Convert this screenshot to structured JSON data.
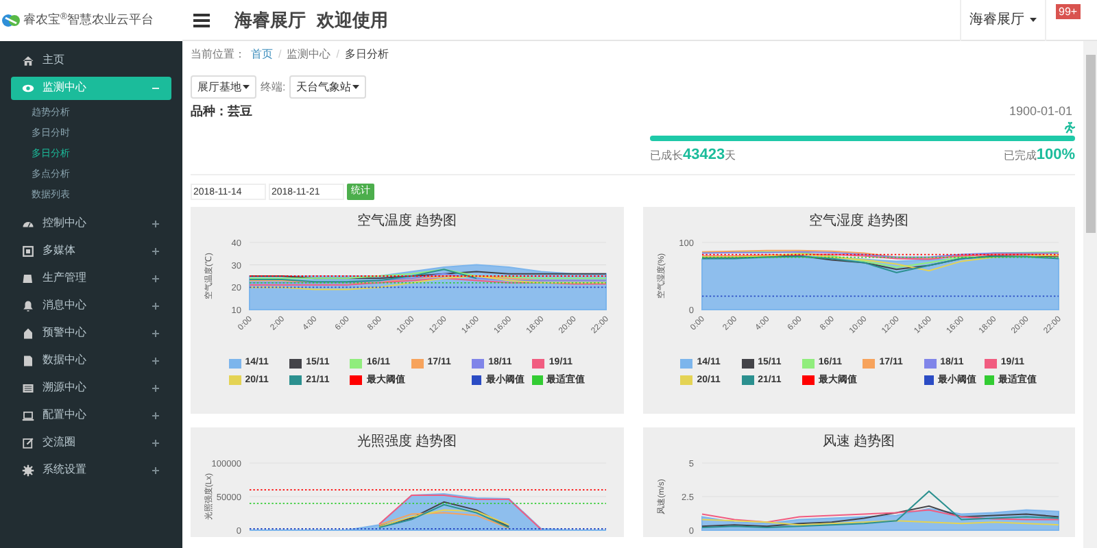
{
  "logo": {
    "text": "睿农宝$^{®}$智慧农业云平台"
  },
  "sidebar": {
    "items": [
      {
        "label": "主页",
        "selected": false,
        "expandable": false
      },
      {
        "label": "监测中心",
        "selected": true,
        "expandable": true,
        "expanded": true,
        "children": [
          {
            "label": "趋势分析",
            "selected": false
          },
          {
            "label": "多日分时",
            "selected": false
          },
          {
            "label": "多日分析",
            "selected": true
          },
          {
            "label": "多点分析",
            "selected": false
          },
          {
            "label": "数据列表",
            "selected": false
          }
        ]
      },
      {
        "label": "控制中心",
        "selected": false,
        "expandable": true,
        "expanded": false
      },
      {
        "label": "多媒体",
        "selected": false,
        "expandable": true,
        "expanded": false
      },
      {
        "label": "生产管理",
        "selected": false,
        "expandable": true,
        "expanded": false
      },
      {
        "label": "消息中心",
        "selected": false,
        "expandable": true,
        "expanded": false
      },
      {
        "label": "预警中心",
        "selected": false,
        "expandable": true,
        "expanded": false
      },
      {
        "label": "数据中心",
        "selected": false,
        "expandable": true,
        "expanded": false
      },
      {
        "label": "溯源中心",
        "selected": false,
        "expandable": true,
        "expanded": false
      },
      {
        "label": "配置中心",
        "selected": false,
        "expandable": true,
        "expanded": false
      },
      {
        "label": "交流圈",
        "selected": false,
        "expandable": true,
        "expanded": false
      },
      {
        "label": "系统设置",
        "selected": false,
        "expandable": true,
        "expanded": false
      }
    ]
  },
  "header": {
    "title": "海睿展厅",
    "welcome": "欢迎使用",
    "user": "海睿展厅",
    "badge": "99+"
  },
  "breadcrumb": {
    "label": "当前位置：",
    "items": [
      {
        "text": "首页",
        "link": true
      },
      {
        "text": "监测中心",
        "link": false
      },
      {
        "text": "多日分析",
        "link": false
      }
    ],
    "separator": "/"
  },
  "filters": {
    "base": "展厅基地",
    "terminal_label": "终端:",
    "terminal": "天台气象站"
  },
  "crop": {
    "variety": "品种：芸豆",
    "date": "1900-01-01",
    "level": 1.0,
    "grown_label": "已成长",
    "grown_days": "43423",
    "days_unit": "天",
    "done_label": "已完成",
    "done_value": "100%"
  },
  "range": {
    "start": "2018-11-14",
    "end": "2018-11-21",
    "button": "统计"
  },
  "charts": [
    {
      "legend": true,
      "chart_data": {
        "type": "line",
        "title": "空气温度 趋势图",
        "ylabel": "空气温度(℃)",
        "categories": [
          "0:00",
          "2:00",
          "4:00",
          "6:00",
          "8:00",
          "10:00",
          "12:00",
          "14:00",
          "16:00",
          "18:00",
          "20:00",
          "22:00"
        ],
        "ylim": [
          10,
          40
        ],
        "yticks": [
          10,
          20,
          30,
          40
        ],
        "series": [
          {
            "name": "14/11",
            "type": "area",
            "color": "#7cb5ec",
            "values": [
              25,
              25,
              25,
              25,
              25,
              27,
              29,
              30,
              29,
              27,
              26,
              26
            ]
          },
          {
            "name": "15/11",
            "color": "#434348",
            "values": [
              25,
              25,
              24,
              24,
              24,
              25,
              26,
              27,
              26,
              26,
              26,
              26
            ]
          },
          {
            "name": "16/11",
            "color": "#90ed7d",
            "values": [
              24,
              24,
              24,
              24,
              25,
              26,
              28,
              25,
              24.5,
              24,
              24,
              24
            ]
          },
          {
            "name": "17/11",
            "color": "#f7a35c",
            "values": [
              23,
              23,
              22,
              22,
              22,
              24,
              25,
              25,
              24,
              23,
              23,
              23
            ]
          },
          {
            "name": "18/11",
            "color": "#8085e9",
            "values": [
              22,
              22,
              22,
              22,
              23,
              24,
              26,
              24,
              23,
              23,
              23,
              23
            ]
          },
          {
            "name": "19/11",
            "color": "#f15c80",
            "values": [
              21,
              21,
              21,
              21,
              22,
              23,
              24,
              23,
              22,
              22,
              21.5,
              21.5
            ]
          },
          {
            "name": "20/11",
            "color": "#e4d354",
            "values": [
              20,
              20,
              19,
              19,
              20,
              22,
              24,
              25,
              23,
              22,
              22,
              22
            ]
          },
          {
            "name": "21/11",
            "color": "#2b908f",
            "values": [
              23.5,
              23.5,
              22.5,
              22.5,
              23,
              25,
              28,
              24,
              null,
              null,
              null,
              null
            ]
          },
          {
            "name": "最大阈值",
            "color": "#ff0000",
            "line_style": "dotted",
            "values": [
              25,
              25,
              25,
              25,
              25,
              25,
              25,
              25,
              25,
              25,
              25,
              25
            ]
          },
          {
            "name": "最小阈值",
            "color": "#2b4cc4",
            "line_style": "dotted",
            "values": [
              20,
              20,
              20,
              20,
              20,
              20,
              20,
              20,
              20,
              20,
              20,
              20
            ]
          },
          {
            "name": "最适宜值",
            "color": "#33cc33",
            "line_style": "dotted",
            "values": [
              22,
              22,
              22,
              22,
              22,
              22,
              22,
              22,
              22,
              22,
              22,
              22
            ]
          }
        ]
      }
    },
    {
      "legend": true,
      "chart_data": {
        "type": "line",
        "title": "空气湿度 趋势图",
        "ylabel": "空气湿度(%)",
        "categories": [
          "0:00",
          "2:00",
          "4:00",
          "6:00",
          "8:00",
          "10:00",
          "12:00",
          "14:00",
          "16:00",
          "18:00",
          "20:00",
          "22:00"
        ],
        "ylim": [
          0,
          100
        ],
        "yticks": [
          0,
          100
        ],
        "series": [
          {
            "name": "14/11",
            "type": "area",
            "color": "#7cb5ec",
            "values": [
              75,
              76,
              78,
              80,
              78,
              75,
              72,
              74,
              76,
              78,
              78,
              76
            ]
          },
          {
            "name": "15/11",
            "color": "#434348",
            "values": [
              77,
              77,
              79,
              80,
              74,
              70,
              60,
              66,
              76,
              80,
              80,
              79
            ]
          },
          {
            "name": "16/11",
            "color": "#90ed7d",
            "values": [
              85,
              86,
              86,
              85,
              80,
              72,
              63,
              70,
              78,
              84,
              85,
              86
            ]
          },
          {
            "name": "17/11",
            "color": "#f7a35c",
            "values": [
              86,
              87,
              88,
              88,
              87,
              84,
              78,
              76,
              80,
              82,
              83,
              84
            ]
          },
          {
            "name": "18/11",
            "color": "#8085e9",
            "values": [
              84,
              85,
              85,
              86,
              85,
              82,
              78,
              78,
              82,
              84,
              84,
              84
            ]
          },
          {
            "name": "19/11",
            "color": "#f15c80",
            "values": [
              80,
              80,
              81,
              82,
              82,
              80,
              76,
              75,
              80,
              82,
              82,
              80
            ]
          },
          {
            "name": "20/11",
            "color": "#e4d354",
            "values": [
              79,
              79,
              80,
              83,
              78,
              74,
              68,
              58,
              72,
              78,
              80,
              81
            ]
          },
          {
            "name": "21/11",
            "color": "#2b908f",
            "values": [
              76,
              76,
              78,
              79,
              76,
              70,
              55,
              66,
              76,
              79,
              79,
              76
            ]
          },
          {
            "name": "最大阈值",
            "color": "#ff0000",
            "line_style": "dotted",
            "values": [
              82,
              82,
              82,
              82,
              82,
              82,
              82,
              82,
              82,
              82,
              82,
              82
            ]
          },
          {
            "name": "最小阈值",
            "color": "#2b4cc4",
            "line_style": "dotted",
            "values": [
              20,
              20,
              20,
              20,
              20,
              20,
              20,
              20,
              20,
              20,
              20,
              20
            ]
          },
          {
            "name": "最适宜值",
            "color": "#33cc33",
            "line_style": "dotted",
            "values": [
              78,
              78,
              78,
              78,
              78,
              78,
              78,
              78,
              78,
              78,
              78,
              78
            ]
          }
        ]
      }
    },
    {
      "legend": false,
      "chart_data": {
        "type": "line",
        "title": "光照强度 趋势图",
        "ylabel": "光照强度(Lx)",
        "ylim": [
          0,
          100000
        ],
        "yticks": [
          0,
          50000,
          100000
        ],
        "series": [
          {
            "type": "area",
            "color": "#7cb5ec",
            "values": [
              0,
              0,
              0,
              0,
              8000,
              52000,
              54000,
              48000,
              47000,
              2000,
              0,
              0
            ]
          },
          {
            "color": "#434348",
            "values": [
              null,
              null,
              null,
              null,
              6000,
              18000,
              42000,
              30000,
              5000,
              null,
              null,
              null
            ]
          },
          {
            "color": "#f7a35c",
            "values": [
              null,
              null,
              null,
              null,
              8000,
              24000,
              26000,
              22000,
              3000,
              null,
              null,
              null
            ]
          },
          {
            "color": "#f15c80",
            "values": [
              null,
              null,
              null,
              null,
              9000,
              52000,
              52000,
              46000,
              46000,
              1000,
              null,
              null
            ]
          },
          {
            "color": "#e4d354",
            "values": [
              null,
              null,
              null,
              null,
              5000,
              20000,
              30000,
              28000,
              8000,
              null,
              null,
              null
            ]
          },
          {
            "color": "#2b908f",
            "values": [
              null,
              null,
              null,
              null,
              4000,
              16000,
              38000,
              26000,
              4000,
              null,
              null,
              null
            ]
          },
          {
            "color": "#ff0000",
            "line_style": "dotted",
            "values": [
              60000,
              60000,
              60000,
              60000,
              60000,
              60000,
              60000,
              60000,
              60000,
              60000,
              60000,
              60000
            ]
          },
          {
            "color": "#2b4cc4",
            "line_style": "dotted",
            "values": [
              2000,
              2000,
              2000,
              2000,
              2000,
              2000,
              2000,
              2000,
              2000,
              2000,
              2000,
              2000
            ]
          },
          {
            "color": "#33cc33",
            "line_style": "dotted",
            "values": [
              40000,
              40000,
              40000,
              40000,
              40000,
              40000,
              40000,
              40000,
              40000,
              40000,
              40000,
              40000
            ]
          }
        ]
      }
    },
    {
      "legend": false,
      "chart_data": {
        "type": "line",
        "title": "风速 趋势图",
        "ylabel": "风速(m/s)",
        "ylim": [
          0,
          5
        ],
        "yticks": [
          0,
          2.5,
          5
        ],
        "series": [
          {
            "type": "area",
            "color": "#7cb5ec",
            "values": [
              1.0,
              0.6,
              0.5,
              0.8,
              0.9,
              1.0,
              1.1,
              1.6,
              1.2,
              1.3,
              1.5,
              1.4
            ]
          },
          {
            "color": "#434348",
            "values": [
              0.3,
              0.4,
              0.3,
              0.5,
              0.6,
              0.9,
              1.3,
              1.8,
              1.0,
              1.1,
              1.2,
              1.0
            ]
          },
          {
            "color": "#f15c80",
            "values": [
              1.2,
              0.8,
              0.6,
              1.0,
              1.1,
              1.2,
              1.3,
              1.5,
              1.0,
              0.85,
              0.8,
              0.8
            ]
          },
          {
            "color": "#e4d354",
            "values": [
              0.8,
              0.7,
              0.6,
              0.4,
              0.5,
              0.6,
              0.7,
              0.6,
              0.5,
              0.6,
              0.5,
              0.4
            ]
          },
          {
            "color": "#2b908f",
            "values": [
              0.2,
              0.3,
              0.2,
              0.3,
              0.4,
              0.5,
              0.7,
              2.9,
              0.8,
              0.9,
              1.0,
              0.9
            ]
          }
        ]
      }
    }
  ]
}
